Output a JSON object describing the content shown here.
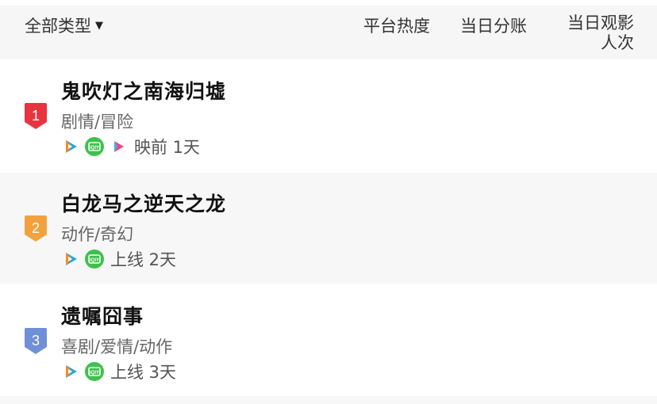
{
  "header": {
    "filter_label": "全部类型",
    "columns": {
      "heat": "平台热度",
      "split": "当日分账",
      "viewers": "当日观影人次"
    }
  },
  "colors": {
    "rank_1": "#e8343f",
    "rank_2": "#f2a23c",
    "rank_3": "#6f8fd6",
    "iqiyi_green": "#3cc24b"
  },
  "rows": [
    {
      "rank": "1",
      "title": "鬼吹灯之南海归墟",
      "genre": "剧情/冒险",
      "platforms": [
        "tencent-video-icon",
        "iqiyi-icon",
        "youku-icon"
      ],
      "release": "映前 1天"
    },
    {
      "rank": "2",
      "title": "白龙马之逆天之龙",
      "genre": "动作/奇幻",
      "platforms": [
        "tencent-video-icon",
        "iqiyi-icon"
      ],
      "release": "上线 2天"
    },
    {
      "rank": "3",
      "title": "遗嘱囧事",
      "genre": "喜剧/爱情/动作",
      "platforms": [
        "tencent-video-icon",
        "iqiyi-icon"
      ],
      "release": "上线 3天"
    }
  ]
}
